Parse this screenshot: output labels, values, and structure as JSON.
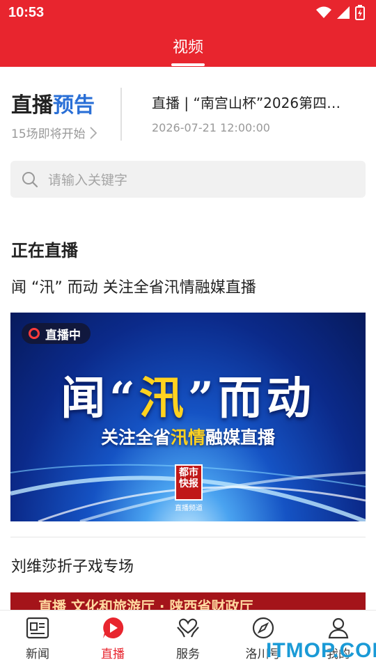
{
  "status_bar": {
    "time": "10:53"
  },
  "header": {
    "tab": "视频"
  },
  "preview": {
    "title_part1": "直播",
    "title_part2": "预告",
    "title_part3": "告",
    "subtitle": "15场即将开始",
    "item_title": "直播 | “南宫山杯”2026第四…",
    "item_time": "2026-07-21 12:00:00"
  },
  "search": {
    "placeholder": "请输入关键字"
  },
  "live": {
    "section_title": "正在直播",
    "items": [
      {
        "title": "闻 “汛” 而动 关注全省汛情融媒直播",
        "badge": "直播中",
        "banner_headline_a": "闻“",
        "banner_headline_b": "汛",
        "banner_headline_c": "”而动",
        "banner_sub_a": "关注全省",
        "banner_sub_b": "汛情",
        "banner_sub_c": "融媒直播",
        "logo_text": "都市快报",
        "logo_caption": "直播频道"
      },
      {
        "title": "刘维莎折子戏专场",
        "banner_text": "直播 文化和旅游厅 · 陕西省财政厅"
      }
    ]
  },
  "bottom_nav": {
    "items": [
      {
        "label": "新闻",
        "icon": "news-icon"
      },
      {
        "label": "直播",
        "icon": "live-play-icon"
      },
      {
        "label": "服务",
        "icon": "service-heart-icon"
      },
      {
        "label": "洛川号",
        "icon": "compass-icon"
      },
      {
        "label": "我的",
        "icon": "profile-icon"
      }
    ],
    "active": "直播"
  },
  "watermark": "ITMOP.COM",
  "colors": {
    "brand_red": "#e8252e",
    "accent_blue": "#2a6fd6"
  }
}
